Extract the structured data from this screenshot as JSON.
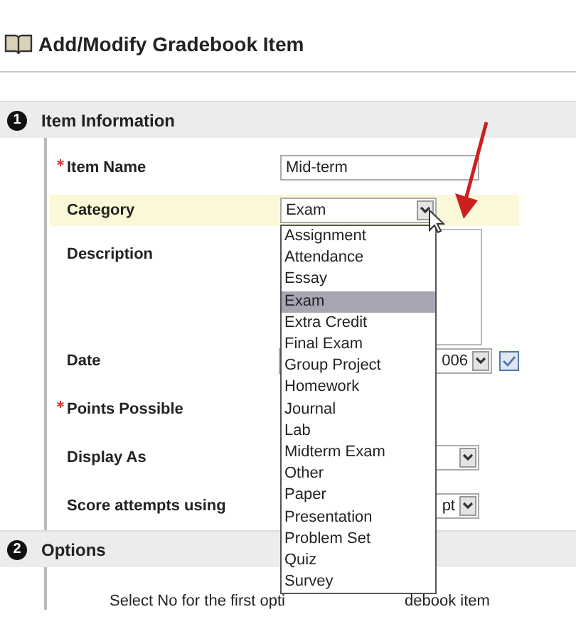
{
  "page_title": "Add/Modify Gradebook Item",
  "sections": [
    {
      "number": "1",
      "title": "Item Information",
      "fields": [
        {
          "label": "Item Name",
          "required": true,
          "kind": "text",
          "value": "Mid-term"
        },
        {
          "label": "Category",
          "required": false,
          "kind": "select",
          "value": "Exam",
          "highlighted": true,
          "open": true,
          "options": [
            {
              "label": "Assignment",
              "selected": false
            },
            {
              "label": "Attendance",
              "selected": false
            },
            {
              "label": "Essay",
              "selected": false
            },
            {
              "label": "Exam",
              "selected": true
            },
            {
              "label": "Extra Credit",
              "selected": false
            },
            {
              "label": "Final Exam",
              "selected": false
            },
            {
              "label": "Group Project",
              "selected": false
            },
            {
              "label": "Homework",
              "selected": false
            },
            {
              "label": "Journal",
              "selected": false
            },
            {
              "label": "Lab",
              "selected": false
            },
            {
              "label": "Midterm Exam",
              "selected": false
            },
            {
              "label": "Other",
              "selected": false
            },
            {
              "label": "Paper",
              "selected": false
            },
            {
              "label": "Presentation",
              "selected": false
            },
            {
              "label": "Problem Set",
              "selected": false
            },
            {
              "label": "Quiz",
              "selected": false
            },
            {
              "label": "Survey",
              "selected": false
            }
          ]
        },
        {
          "label": "Description",
          "required": false,
          "kind": "textarea"
        },
        {
          "label": "Date",
          "required": false,
          "kind": "date",
          "value": "006"
        },
        {
          "label": "Points Possible",
          "required": true,
          "kind": "covered"
        },
        {
          "label": "Display As",
          "required": false,
          "kind": "select"
        },
        {
          "label": "Score attempts using",
          "required": false,
          "kind": "select",
          "value": "pt"
        }
      ]
    },
    {
      "number": "2",
      "title": "Options",
      "instruction_start": "Select No for the first opti",
      "instruction_end": "debook item"
    }
  ]
}
